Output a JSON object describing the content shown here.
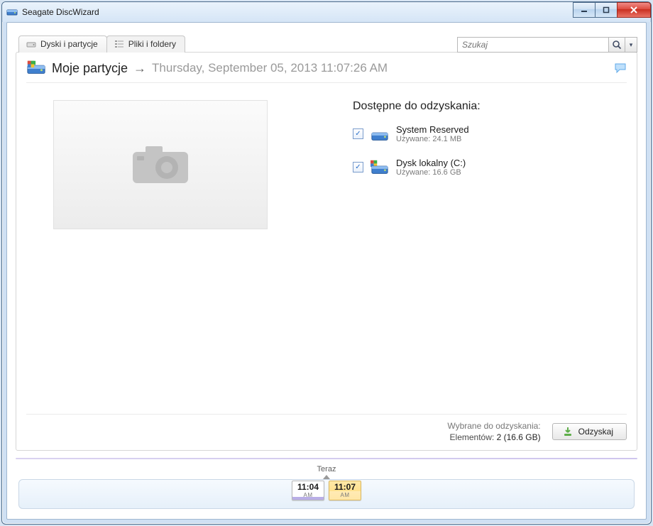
{
  "window": {
    "title": "Seagate DiscWizard"
  },
  "tabs": {
    "disks": "Dyski i partycje",
    "files": "Pliki i foldery"
  },
  "search": {
    "placeholder": "Szukaj"
  },
  "header": {
    "name": "Moje partycje",
    "timestamp": "Thursday, September 05, 2013 11:07:26 AM"
  },
  "recover": {
    "heading": "Dostępne do odzyskania:",
    "used_label": "Używane:",
    "partitions": [
      {
        "name": "System Reserved",
        "used": "24.1 MB",
        "checked": true,
        "has_flag": false
      },
      {
        "name": "Dysk lokalny (C:)",
        "used": "16.6 GB",
        "checked": true,
        "has_flag": true
      }
    ]
  },
  "summary": {
    "selected_label": "Wybrane do odzyskania:",
    "elements_label": "Elementów:",
    "count": "2",
    "size": "(16.6 GB)"
  },
  "buttons": {
    "recover": "Odzyskaj"
  },
  "timeline": {
    "now_label": "Teraz",
    "points": [
      {
        "time": "11:04",
        "period": "AM",
        "active": false
      },
      {
        "time": "11:07",
        "period": "AM",
        "active": true
      }
    ]
  }
}
